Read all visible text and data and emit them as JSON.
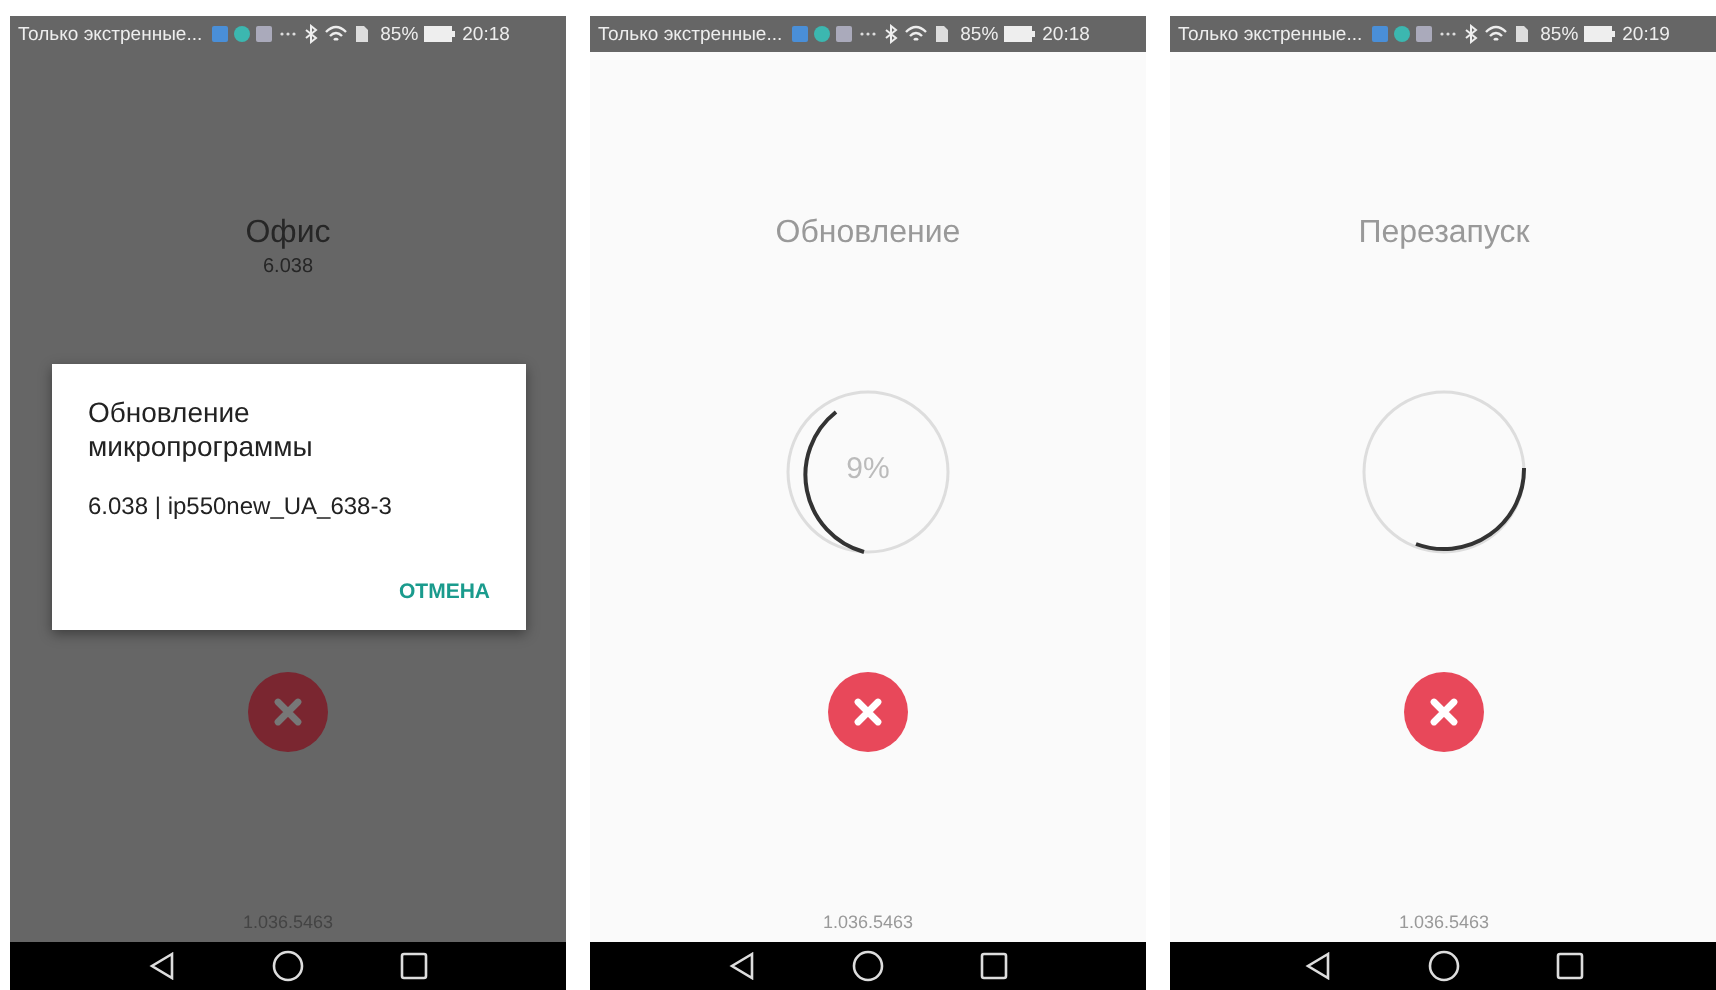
{
  "screens": [
    {
      "status_bar": {
        "notice": "Только экстренные...",
        "battery": "85%",
        "time": "20:18"
      },
      "kind": "plain",
      "title": "Офис",
      "subtitle": "6.038",
      "dimmed": true,
      "dialog": {
        "title": "Обновление микропрограммы",
        "message": "6.038 | ip550new_UA_638-3",
        "action": "ОТМЕНА"
      },
      "version": "1.036.5463"
    },
    {
      "status_bar": {
        "notice": "Только экстренные...",
        "battery": "85%",
        "time": "20:18"
      },
      "kind": "progress",
      "title": "Обновление",
      "progress_text": "9%",
      "dimmed": false,
      "version": "1.036.5463"
    },
    {
      "status_bar": {
        "notice": "Только экстренные...",
        "battery": "85%",
        "time": "20:19"
      },
      "kind": "restart",
      "title": "Перезапуск",
      "dimmed": false,
      "version": "1.036.5463"
    }
  ]
}
